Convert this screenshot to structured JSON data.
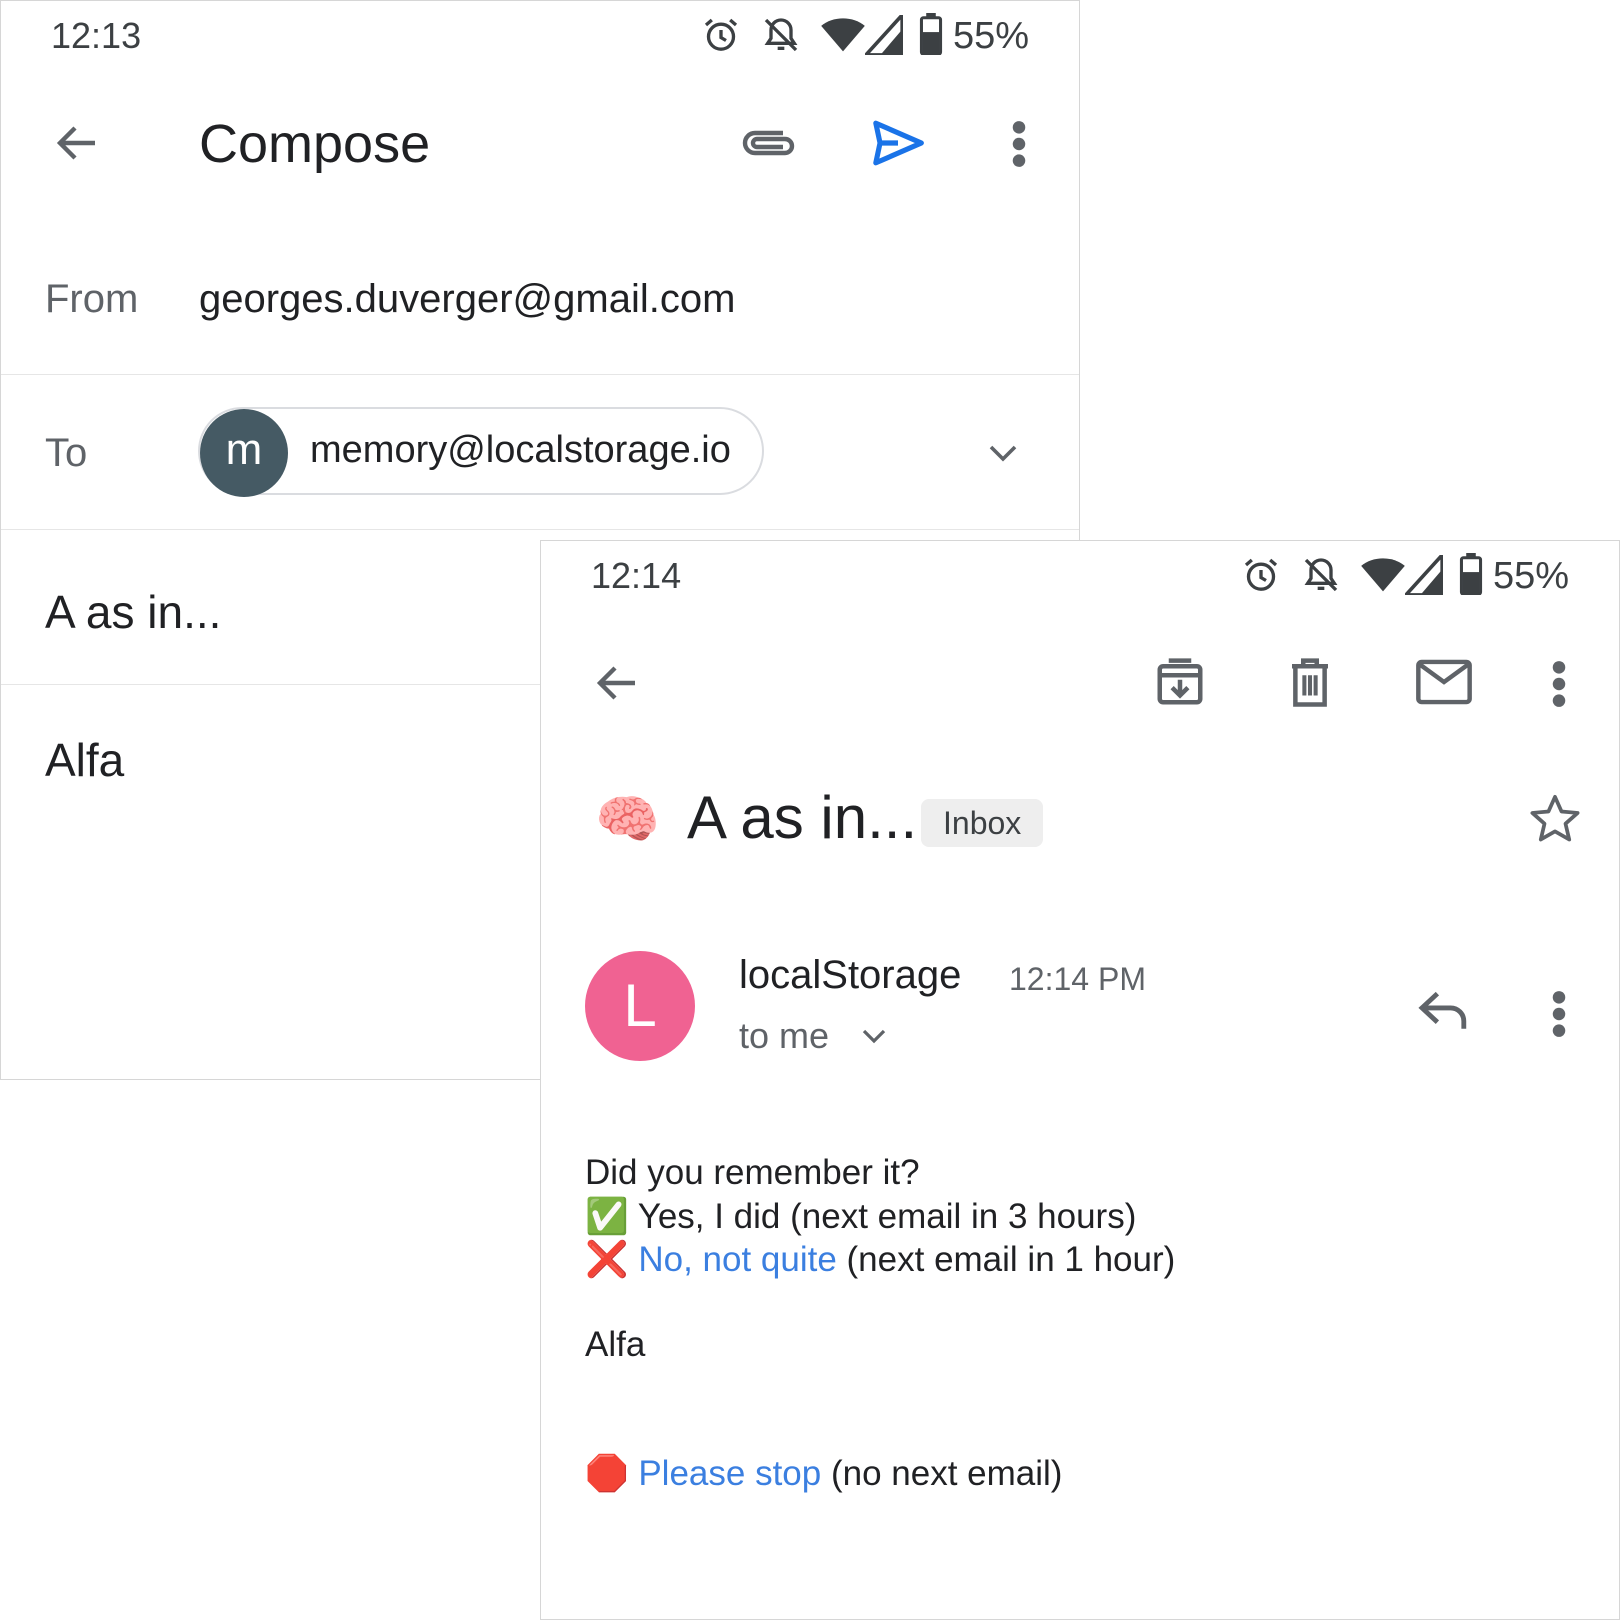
{
  "compose": {
    "status": {
      "time": "12:13",
      "battery": "55%"
    },
    "toolbar": {
      "title": "Compose"
    },
    "from": {
      "label": "From",
      "value": "georges.duverger@gmail.com"
    },
    "to": {
      "label": "To",
      "chip_initial": "m",
      "chip_email": "memory@localstorage.io"
    },
    "subject": "A as in...",
    "body": "Alfa"
  },
  "email": {
    "status": {
      "time": "12:14",
      "battery": "55%"
    },
    "subject": "A as in...",
    "subject_emoji": "🧠",
    "badge": "Inbox",
    "sender": {
      "initial": "L",
      "name": "localStorage",
      "time": "12:14 PM",
      "to": "to me"
    },
    "body": {
      "question": "Did you remember it?",
      "yes_emoji": "✅",
      "yes_text": "Yes, I did (next email in 3 hours)",
      "no_emoji": "❌",
      "no_link": "No, not quite",
      "no_text": "(next email in 1 hour)",
      "word": "Alfa",
      "stop_emoji": "🛑",
      "stop_link": "Please stop",
      "stop_text": "(no next email)"
    }
  },
  "icons": [
    "back-arrow-icon",
    "attach-icon",
    "send-icon",
    "more-vert-icon",
    "chevron-down-icon",
    "archive-icon",
    "trash-icon",
    "mail-icon",
    "star-icon",
    "reply-icon",
    "alarm-icon",
    "bell-off-icon",
    "wifi-icon",
    "signal-icon",
    "battery-icon"
  ],
  "colors": {
    "send_blue": "#1a73e8",
    "link_blue": "#3b7fe0",
    "chip_avatar": "#455a64",
    "sender_avatar": "#f06292"
  }
}
